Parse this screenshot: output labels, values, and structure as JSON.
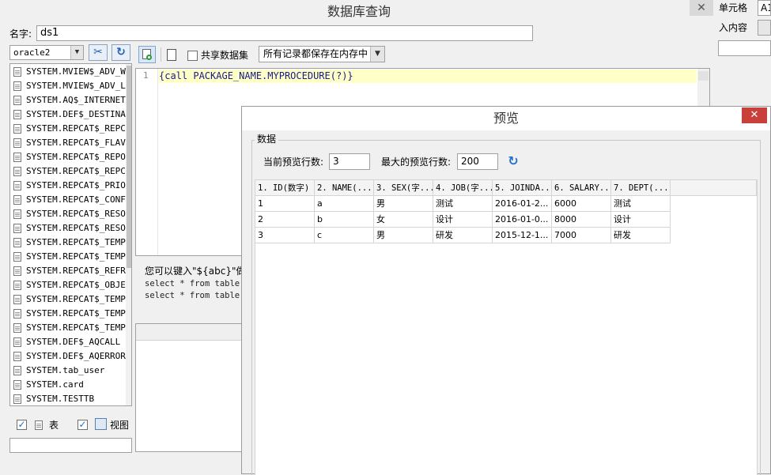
{
  "main": {
    "title": "数据库查询",
    "close": "✕",
    "name_label": "名字:",
    "name_value": "ds1",
    "connection": "oracle2",
    "shared_dataset_label": "共享数据集",
    "memory_mode": "所有记录都保存在内存中",
    "tables": [
      "SYSTEM.MVIEW$_ADV_WO",
      "SYSTEM.MVIEW$_ADV_LO",
      "SYSTEM.AQ$_INTERNET_A",
      "SYSTEM.DEF$_DESTINATI",
      "SYSTEM.REPCAT$_REPCAT",
      "SYSTEM.REPCAT$_FLAVOR",
      "SYSTEM.REPCAT$_REPOB",
      "SYSTEM.REPCAT$_REPCAT",
      "SYSTEM.REPCAT$_PRIORI",
      "SYSTEM.REPCAT$_CONFLI",
      "SYSTEM.REPCAT$_RESOLU",
      "SYSTEM.REPCAT$_RESOLU",
      "SYSTEM.REPCAT$_TEMPLA",
      "SYSTEM.REPCAT$_TEMPLA",
      "SYSTEM.REPCAT$_REFRES",
      "SYSTEM.REPCAT$_OBJECT",
      "SYSTEM.REPCAT$_TEMPLA",
      "SYSTEM.REPCAT$_TEMPLA",
      "SYSTEM.REPCAT$_TEMPLA",
      "SYSTEM.DEF$_AQCALL",
      "SYSTEM.DEF$_AQERROR",
      "SYSTEM.tab_user",
      "SYSTEM.card",
      "SYSTEM.TESTTB"
    ],
    "table_check_label": "表",
    "view_check_label": "视图",
    "line_number": "1",
    "sql": "{call PACKAGE_NAME.MYPROCEDURE(?)}",
    "hint_line1": "您可以键入\"${abc}\"做",
    "hint_line2": "select * from table w",
    "hint_line3": "select * from table w"
  },
  "right": {
    "cell_label": "单元格",
    "cell_value": "A1",
    "insert_label": "入内容"
  },
  "preview": {
    "title": "预览",
    "close": "✕",
    "group_label": "数据",
    "current_rows_label": "当前预览行数:",
    "current_rows_value": "3",
    "max_rows_label": "最大的预览行数:",
    "max_rows_value": "200",
    "columns": [
      "1. ID(数字)",
      "2. NAME(...",
      "3. SEX(字...",
      "4. JOB(字...",
      "5. JOINDA...",
      "6. SALARY...",
      "7. DEPT(..."
    ],
    "rows": [
      [
        "1",
        "a",
        "男",
        "测试",
        "2016-01-2...",
        "6000",
        "测试"
      ],
      [
        "2",
        "b",
        "女",
        "设计",
        "2016-01-0...",
        "8000",
        "设计"
      ],
      [
        "3",
        "c",
        "男",
        "研发",
        "2015-12-1...",
        "7000",
        "研发"
      ]
    ]
  },
  "colors": {
    "accent": "#1f5fb7",
    "close_red": "#c9403a",
    "sql_highlight": "#ffffc8"
  }
}
